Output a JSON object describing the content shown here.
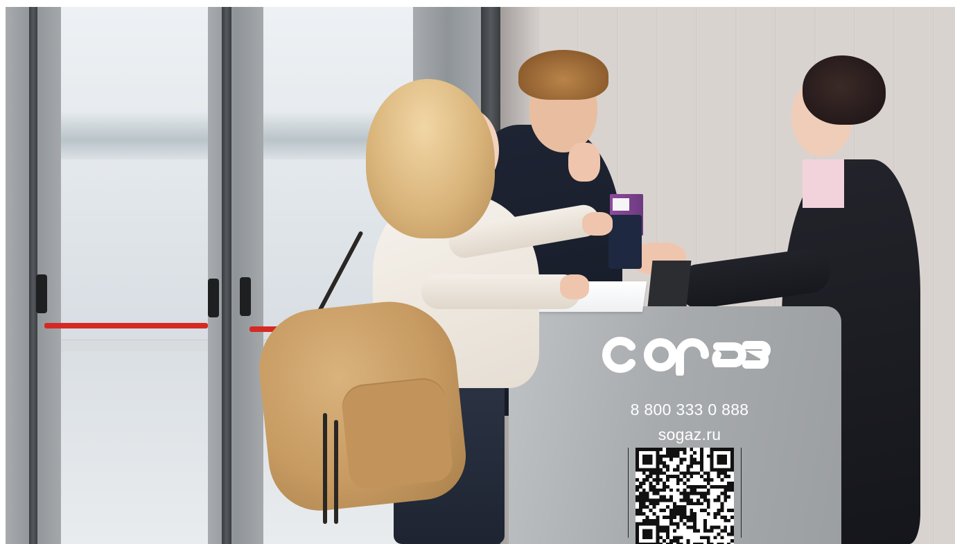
{
  "brand": {
    "logo_text": "согаз",
    "phone": "8 800 333 0 888",
    "website": "sogaz.ru"
  },
  "colors": {
    "logo": "#ffffff",
    "exit_bar": "#d42a23",
    "jacket": "#1a1f2c",
    "backpack": "#c79b62"
  },
  "scene": {
    "icons": [
      "qr-code-icon",
      "boarding-pass-icon",
      "passport-icon",
      "backpack-icon"
    ]
  }
}
